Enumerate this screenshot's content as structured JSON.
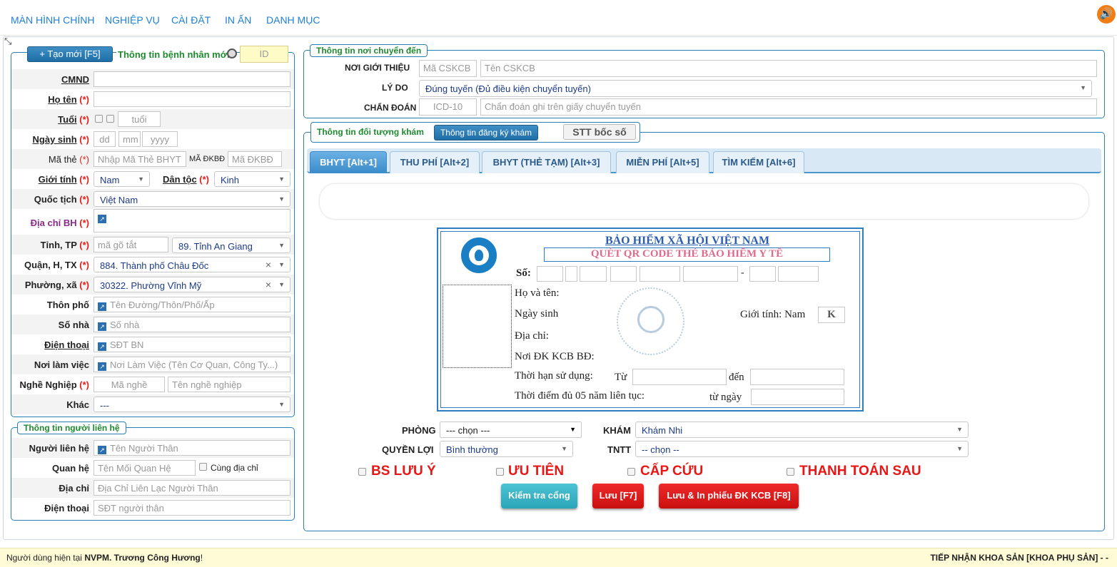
{
  "menu": [
    "MÀN HÌNH CHÍNH",
    "NGHIỆP VỤ",
    "CÀI ĐẶT",
    "IN ẤN",
    "DANH MỤC"
  ],
  "patient": {
    "new_button": "+ Tạo mới [F5]",
    "title": "Thông tin bệnh nhân mới",
    "id_placeholder": "ID",
    "fields": {
      "cmnd_label": "CMND",
      "hoten_label": "Họ tên",
      "tuoi_label": "Tuổi",
      "tuoi_placeholder": "tuổi",
      "ngaysinh_label": "Ngày sinh",
      "dd": "dd",
      "mm": "mm",
      "yyyy": "yyyy",
      "mathe_label": "Mã thẻ",
      "mathe_placeholder": "Nhập Mã Thẻ BHYT",
      "madkbd_label": "MÃ ĐKBĐ",
      "madkbd_placeholder": "Mã ĐKBĐ",
      "gioitinh_label": "Giới tính",
      "gioitinh_value": "Nam",
      "dantoc_label": "Dân tộc",
      "dantoc_value": "Kinh",
      "quoctich_label": "Quốc tịch",
      "quoctich_value": "Việt Nam",
      "diachi_label": "Địa chỉ BH",
      "tinh_label": "Tỉnh, TP",
      "tinh_placeholder": "mã gõ tắt",
      "tinh_value": "89. Tỉnh An Giang",
      "quan_label": "Quận, H, TX",
      "quan_value": "884. Thành phố Châu Đốc",
      "phuong_label": "Phường, xã",
      "phuong_value": "30322. Phường Vĩnh Mỹ",
      "thonpho_label": "Thôn phố",
      "thonpho_placeholder": "Tên Đường/Thôn/Phố/Ấp",
      "sonha_label": "Số nhà",
      "sonha_placeholder": "Số nhà",
      "dienthoai_label": "Điện thoại",
      "dienthoai_placeholder": "SĐT BN",
      "noilamviec_label": "Nơi làm việc",
      "noilamviec_placeholder": "Nơi Làm Việc (Tên Cơ Quan, Công Ty...)",
      "nghenghiep_label": "Nghề Nghiệp",
      "manghe_placeholder": "Mã nghề",
      "tennghe_placeholder": "Tên nghề nghiệp",
      "khac_label": "Khác",
      "khac_value": "---",
      "req": "(*)"
    }
  },
  "contact": {
    "title": "Thông tin người liên hệ",
    "nguoi_label": "Người liên hệ",
    "nguoi_placeholder": "Tên Người Thân",
    "quanhe_label": "Quan hệ",
    "quanhe_placeholder": "Tên Mối Quan Hệ",
    "cungdiachi": "Cùng địa chỉ",
    "diachi_label": "Địa chỉ",
    "diachi_placeholder": "Địa Chỉ Liên Lạc Người Thân",
    "dienthoai_label": "Điện thoại",
    "dienthoai_placeholder": "SĐT người thân"
  },
  "transfer": {
    "title": "Thông tin nơi chuyển đến",
    "noigioithieu_label": "NƠI GIỚI THIỆU",
    "macskcb_placeholder": "Mã CSKCB",
    "tencskcb_placeholder": "Tên CSKCB",
    "lydo_label": "LÝ DO",
    "lydo_value": "Đúng tuyến (Đủ điều kiện chuyển tuyến)",
    "chandoan_label": "CHẨN ĐOÁN",
    "icd_placeholder": "ICD-10",
    "chandoan_placeholder": "Chẩn đoán ghi trên giấy chuyển tuyến"
  },
  "exam": {
    "title": "Thông tin đối tượng khám",
    "reg_button": "Thông tin đăng ký khám",
    "stt_button": "STT bốc số",
    "tabs": [
      "BHYT [Alt+1]",
      "THU PHÍ [Alt+2]",
      "BHYT (THẺ TẠM) [Alt+3]",
      "MIỄN PHÍ [Alt+5]",
      "TÌM KIẾM [Alt+6]"
    ]
  },
  "card": {
    "title": "BẢO HIỂM XÃ HỘI VIỆT NAM",
    "qr": "QUÉT QR CODE THẺ BẢO HIỂM Y TẾ",
    "so": "Số:",
    "dash": "-",
    "hoten": "Họ và tên:",
    "ngaysinh": "Ngày sinh",
    "gioitinh": "Giới tính: Nam",
    "k": "K",
    "diachi": "Địa chỉ:",
    "noidk": "Nơi ĐK KCB BĐ:",
    "thoihan": "Thời hạn sử dụng:",
    "tu": "Từ",
    "den": "đến",
    "thoidiem": "Thời điểm đủ 05 năm liên tục:",
    "tungay": "từ ngày"
  },
  "bottom": {
    "phong_label": "PHÒNG",
    "phong_value": "--- chọn ---",
    "kham_label": "KHÁM",
    "kham_value": "Khám Nhi",
    "quyenloi_label": "QUYỀN LỢI",
    "quyenloi_value": "Bình thường",
    "tntt_label": "TNTT",
    "tntt_value": "-- chọn --",
    "flags": [
      "BS LƯU Ý",
      "ƯU TIÊN",
      "CẤP CỨU",
      "THANH TOÁN SAU"
    ],
    "check_button": "Kiểm tra cổng",
    "save_button": "Lưu [F7]",
    "save_print_button": "Lưu & In phiếu ĐK KCB [F8]"
  },
  "status": {
    "prefix": "Người dùng hiện tại ",
    "user": "NVPM. Trương Công Hương",
    "suffix": "!",
    "right": "TIẾP NHẬN KHOA SẢN [KHOA PHỤ SẢN] - -"
  },
  "colors": {
    "accent": "#1e7fd6",
    "required": "#e0201a",
    "legend_green": "#1d8a2e",
    "danger": "#e0201a",
    "teal": "#2fb3c5"
  }
}
